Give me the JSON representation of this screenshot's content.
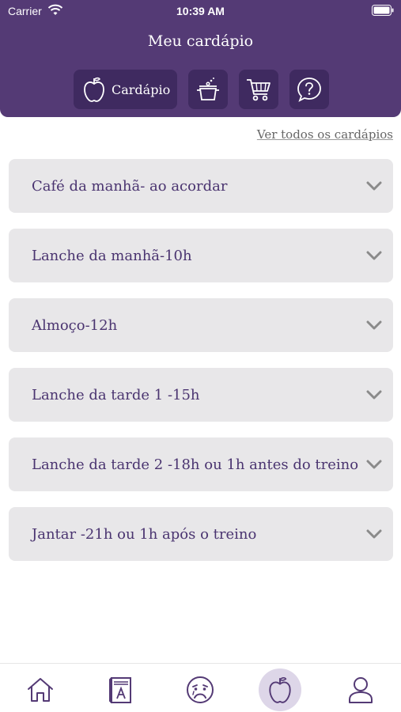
{
  "status_bar": {
    "carrier": "Carrier",
    "time": "10:39 AM"
  },
  "header": {
    "title": "Meu cardápio",
    "tools": [
      {
        "label": "Cardápio",
        "icon": "apple-icon"
      },
      {
        "icon": "cooking-pot-icon"
      },
      {
        "icon": "shopping-cart-icon"
      },
      {
        "icon": "help-question-icon"
      }
    ]
  },
  "links": {
    "see_all": "Ver todos os cardápios"
  },
  "meals": [
    {
      "label": "Café da manhã- ao acordar"
    },
    {
      "label": "Lanche da manhã-10h"
    },
    {
      "label": "Almoço-12h"
    },
    {
      "label": "Lanche da tarde 1 -15h"
    },
    {
      "label": "Lanche da tarde 2 -18h ou 1h antes do treino"
    },
    {
      "label": "Jantar -21h ou 1h após o treino"
    }
  ],
  "tabbar": {
    "items": [
      {
        "icon": "home-icon"
      },
      {
        "icon": "book-icon"
      },
      {
        "icon": "sad-face-icon"
      },
      {
        "icon": "apple-icon",
        "active": true
      },
      {
        "icon": "user-icon"
      }
    ]
  },
  "colors": {
    "primary": "#543a75",
    "primary_dark": "#3f2a60",
    "card_bg": "#e8e7e9",
    "text": "#4a3470"
  }
}
